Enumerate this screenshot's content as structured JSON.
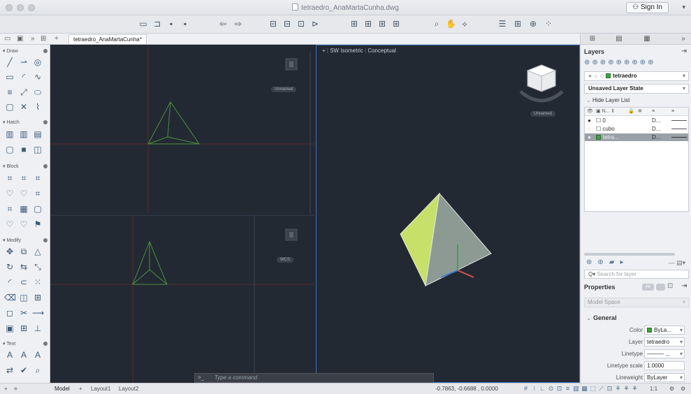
{
  "window": {
    "title": "tetraedro_AnaMartaCunha.dwg",
    "sign_in": "Sign In"
  },
  "file_tab": {
    "label": "tetraedro_AnaMartaCunha*"
  },
  "left_palette": {
    "sections": [
      "Draw",
      "Hatch",
      "Block",
      "Modify",
      "Text"
    ]
  },
  "viewports": {
    "right_label_plus": "+",
    "right_label_view": "SW Isometric",
    "right_label_style": "Conceptual",
    "top_left_wcs": "Unnamed",
    "bottom_left_wcs": "WCS",
    "right_wcs": "Unnamed"
  },
  "command": {
    "prompt": ">_",
    "placeholder": "Type a command"
  },
  "status_bar": {
    "tabs": [
      "Model",
      "Layout1",
      "Layout2"
    ],
    "coordinates": "-0.7863,  -0.6688 , 0.0000",
    "scale": "1:1"
  },
  "layers_panel": {
    "title": "Layers",
    "current_layer": "tetraedro",
    "layer_state": "Unsaved Layer State",
    "hide_list": "Hide Layer List",
    "columns": [
      "N...",
      "D..."
    ],
    "rows": [
      {
        "name": "0",
        "desc": "D...",
        "color": "#ffffff"
      },
      {
        "name": "cubo",
        "desc": "D...",
        "color": "#ffffff"
      },
      {
        "name": "tetra...",
        "desc": "D...",
        "color": "#3aa53a"
      }
    ],
    "search_placeholder": "Search for layer"
  },
  "properties_panel": {
    "title": "Properties",
    "filter_all": "All",
    "context": "Model Space",
    "section": "General",
    "rows": [
      {
        "key": "Color",
        "value": "ByLa..."
      },
      {
        "key": "Layer",
        "value": "tetraedro"
      },
      {
        "key": "Linetype",
        "value": "——— ..."
      },
      {
        "key": "Linetype scale",
        "value": "1.0000"
      },
      {
        "key": "Lineweight",
        "value": "ByLayer"
      }
    ]
  },
  "colors": {
    "tetra_face_light": "#c7e06a",
    "tetra_face_grey": "#8c9a93",
    "wire_green": "#4f8f3f"
  }
}
